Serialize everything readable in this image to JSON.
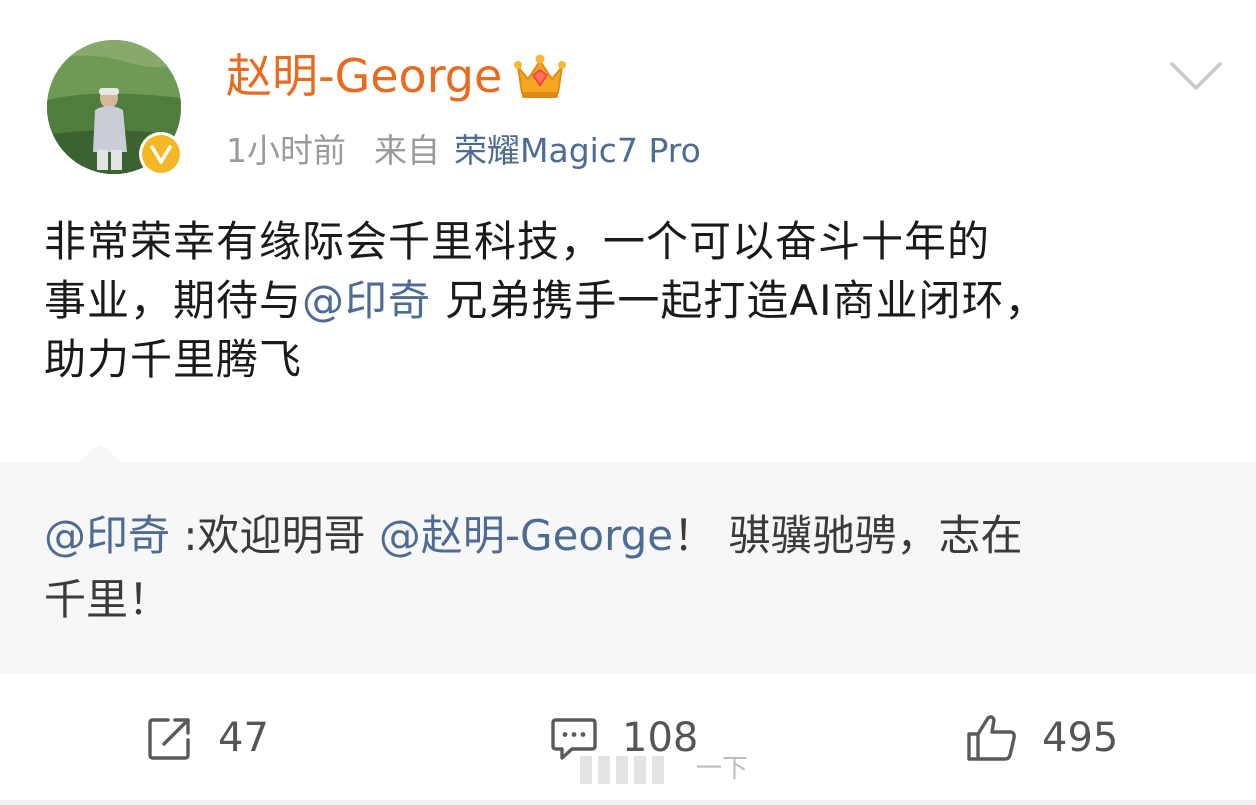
{
  "post": {
    "author": {
      "name": "赵明-George",
      "verified_color": "#f5b824",
      "name_color": "#e86b1f"
    },
    "meta": {
      "time": "1小时前",
      "from_label": "来自",
      "device": "荣耀Magic7 Pro"
    },
    "text": {
      "line1": "非常荣幸有缘际会千里科技，一个可以奋斗十年的",
      "line2_pre": "事业，期待与",
      "line2_mention": "@印奇",
      "line2_post": " 兄弟携手一起打造AI商业闭环，",
      "line3": "助力千里腾飞"
    },
    "reply": {
      "mention_author": "@印奇",
      "pre": " :欢迎明哥 ",
      "mention_target": "@赵明-George",
      "post": "！  骐骥驰骋，志在",
      "line2": "千里！"
    },
    "actions": {
      "repost_count": "47",
      "comment_count": "108",
      "like_count": "495"
    },
    "toast": {
      "text": "一下"
    },
    "icons": {
      "more": "chevron-down-icon",
      "repost": "repost-icon",
      "comment": "comment-icon",
      "like": "thumbs-up-icon",
      "vip": "crown-icon",
      "verified": "verified-icon"
    },
    "colors": {
      "link": "#4d6c93",
      "muted": "#9a9a9a",
      "text": "#1a1a1a",
      "reply_bg": "#f7f7f7"
    }
  }
}
